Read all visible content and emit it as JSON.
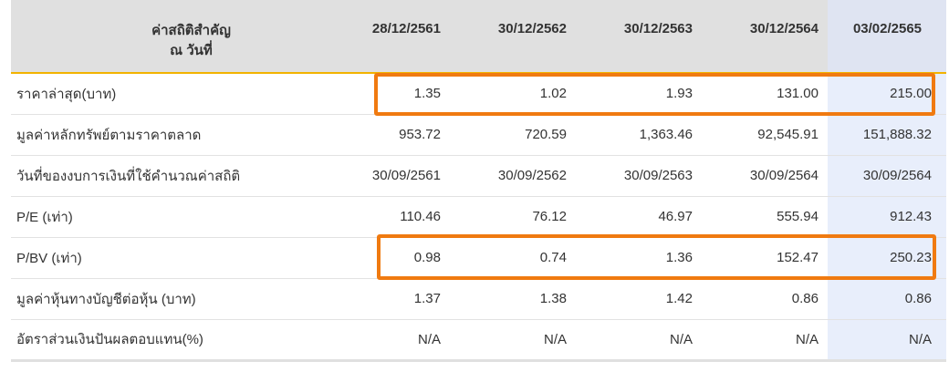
{
  "header": {
    "label_line1": "ค่าสถิติสำคัญ",
    "label_line2": "ณ วันที่",
    "dates": [
      "28/12/2561",
      "30/12/2562",
      "30/12/2563",
      "30/12/2564",
      "03/02/2565"
    ]
  },
  "rows": [
    {
      "label": "ราคาล่าสุด(บาท)",
      "values": [
        "1.35",
        "1.02",
        "1.93",
        "131.00",
        "215.00"
      ]
    },
    {
      "label": "มูลค่าหลักทรัพย์ตามราคาตลาด",
      "values": [
        "953.72",
        "720.59",
        "1,363.46",
        "92,545.91",
        "151,888.32"
      ]
    },
    {
      "label": "วันที่ของงบการเงินที่ใช้คำนวณค่าสถิติ",
      "values": [
        "30/09/2561",
        "30/09/2562",
        "30/09/2563",
        "30/09/2564",
        "30/09/2564"
      ]
    },
    {
      "label": "P/E (เท่า)",
      "values": [
        "110.46",
        "76.12",
        "46.97",
        "555.94",
        "912.43"
      ]
    },
    {
      "label": "P/BV (เท่า)",
      "values": [
        "0.98",
        "0.74",
        "1.36",
        "152.47",
        "250.23"
      ]
    },
    {
      "label": "มูลค่าหุ้นทางบัญชีต่อหุ้น (บาท)",
      "values": [
        "1.37",
        "1.38",
        "1.42",
        "0.86",
        "0.86"
      ]
    },
    {
      "label": "อัตราส่วนเงินปันผลตอบแทน(%)",
      "values": [
        "N/A",
        "N/A",
        "N/A",
        "N/A",
        "N/A"
      ]
    }
  ],
  "colors": {
    "header_bg": "#e0e0e0",
    "header_underline": "#f2b300",
    "latest_column_bg": "#e8eefb",
    "highlight_box": "#f07a10"
  }
}
